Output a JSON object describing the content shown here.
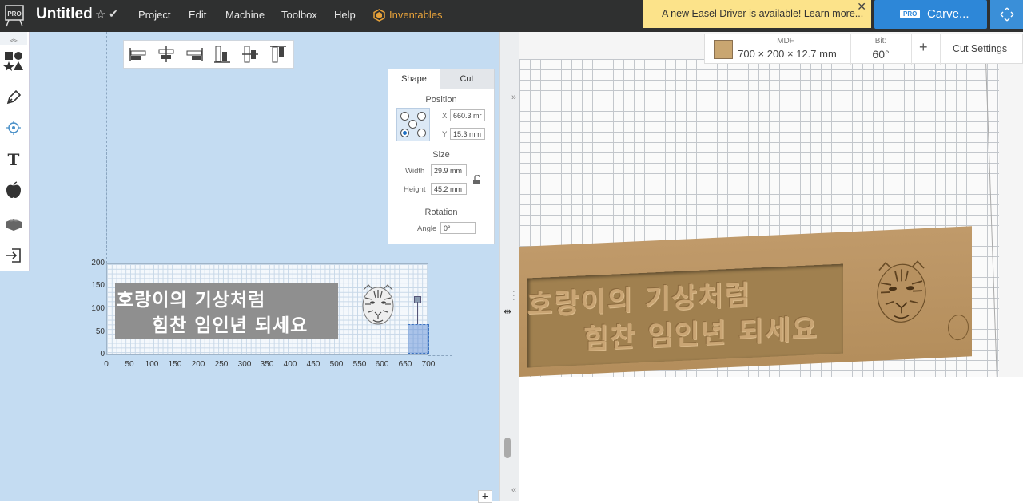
{
  "header": {
    "logo_label": "PRO",
    "title": "Untitled",
    "menu": [
      "Project",
      "Edit",
      "Machine",
      "Toolbox",
      "Help"
    ],
    "inventables_label": "Inventables",
    "notice": "A new Easel Driver is available! Learn more...",
    "notice_close": "✕",
    "carve_badge": "PRO",
    "carve_label": "Carve..."
  },
  "left_tools": [
    "shapes-icon",
    "pen-icon",
    "point-icon",
    "text-icon",
    "apple-icon",
    "lego-icon",
    "import-icon"
  ],
  "text_tool_glyph": "T",
  "shape_panel": {
    "tabs": [
      "Shape",
      "Cut"
    ],
    "position_title": "Position",
    "x_label": "X",
    "x_value": "660.3 mr",
    "y_label": "Y",
    "y_value": "15.3 mm",
    "size_title": "Size",
    "width_label": "Width",
    "width_value": "29.9 mm",
    "height_label": "Height",
    "height_value": "45.2 mm",
    "rotation_title": "Rotation",
    "angle_label": "Angle",
    "angle_value": "0°"
  },
  "canvas": {
    "line1": "호랑이의 기상처럼",
    "line2": "힘찬 임인년 되세요",
    "y_ticks": [
      "200",
      "150",
      "100",
      "50",
      "0"
    ],
    "x_ticks": [
      "0",
      "50",
      "100",
      "150",
      "200",
      "250",
      "300",
      "350",
      "400",
      "450",
      "500",
      "550",
      "600",
      "650",
      "700"
    ]
  },
  "material": {
    "name": "MDF",
    "dims": "700 × 200 × 12.7 mm",
    "bit_label": "Bit:",
    "bit_value": "60°",
    "plus": "+",
    "cut_settings": "Cut Settings"
  },
  "divider": {
    "chevron_top": "»",
    "chevron_bottom": "«",
    "plus": "+"
  }
}
